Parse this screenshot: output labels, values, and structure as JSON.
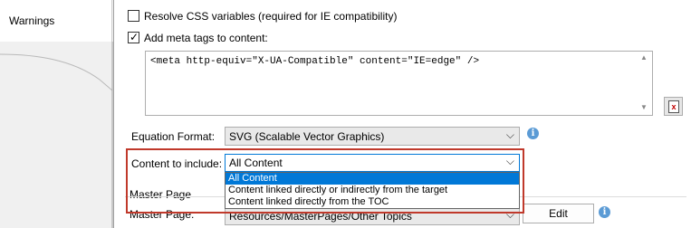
{
  "left_tabs": {
    "warnings": "Warnings"
  },
  "options": {
    "resolve_css": {
      "label": "Resolve CSS variables (required for IE compatibility)",
      "checked": false
    },
    "add_meta": {
      "label": "Add meta tags to content:",
      "checked": true
    },
    "meta_text": "<meta http-equiv=\"X-UA-Compatible\" content=\"IE=edge\" />"
  },
  "equation": {
    "label": "Equation Format:",
    "value": "SVG (Scalable Vector Graphics)"
  },
  "content": {
    "label": "Content to include:",
    "value": "All Content",
    "options": [
      "All Content",
      "Content linked directly or indirectly from the target",
      "Content linked directly from the TOC"
    ]
  },
  "master_page": {
    "section_label": "Master Page",
    "label": "Master Page:",
    "value": "Resources/MasterPages/Other Topics",
    "edit_label": "Edit"
  },
  "icons": {
    "info": "info-icon",
    "chevron": "chevron-down-icon",
    "excel": "excel-icon"
  },
  "colors": {
    "highlight": "#c0392b",
    "selection": "#0078d7",
    "info": "#5b9bd5"
  }
}
